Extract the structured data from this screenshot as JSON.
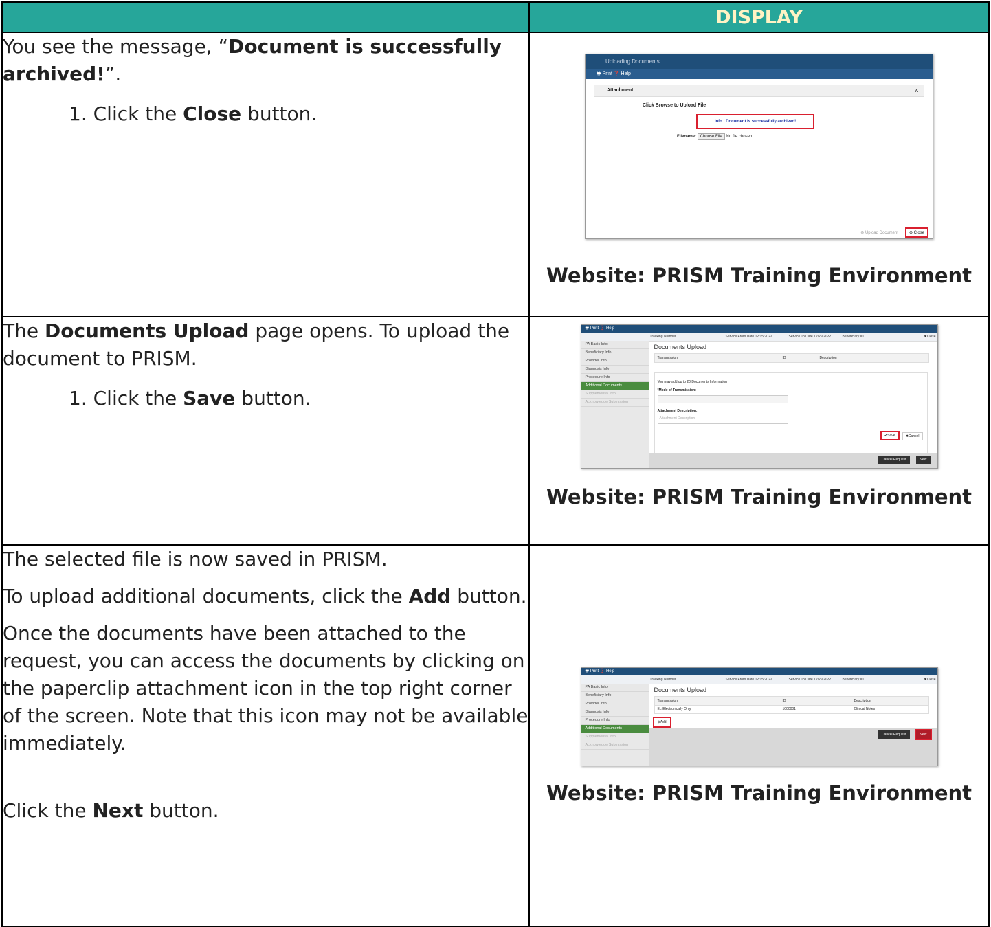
{
  "header": {
    "left": "",
    "right": "DISPLAY"
  },
  "rows": [
    {
      "intro_prefix": "You see the message, “",
      "intro_bold": "Document is successfully archived!",
      "intro_suffix": "”.",
      "step_pre": "1.  Click the ",
      "step_bold": "Close",
      "step_post": " button.",
      "caption": "Website: PRISM Training Environment"
    },
    {
      "intro_prefix": "The ",
      "intro_bold": "Documents Upload",
      "intro_suffix": " page opens. To upload the document to PRISM.",
      "step_pre": "1.  Click the ",
      "step_bold": "Save",
      "step_post": " button.",
      "caption": "Website: PRISM Training Environment"
    },
    {
      "p1": "The selected file is now saved in PRISM.",
      "p2_pre": "To upload additional documents, click the ",
      "p2_bold": "Add",
      "p2_post": " button.",
      "p3": "Once the documents have been attached to the request, you can access the documents by clicking on the paperclip attachment icon in the top right corner of the screen. Note that this icon may not be available immediately.",
      "p4_pre": "Click the ",
      "p4_bold": "Next",
      "p4_post": " button.",
      "caption": "Website: PRISM Training Environment"
    }
  ],
  "shot1": {
    "title": "Uploading Documents",
    "toolbar": "🖶 Print  ❓ Help",
    "panel_title": "Attachment:",
    "browse": "Click Browse to Upload File",
    "info": "Info :  Document is successfully archived!",
    "filename_label": "Filename:",
    "choose": "Choose File",
    "nofile": "No file chosen",
    "upload_btn": "⊕ Upload Document",
    "close_btn": "⊗ Close"
  },
  "portal": {
    "toolbar": "🖶 Print  ❓ Help",
    "tracking": "Tracking Number",
    "from": "Service From Date 12/15/2022",
    "to": "Service To Date 12/29/2022",
    "bene": "Beneficiary ID",
    "close": "✖Close",
    "side": [
      "PA Basic Info",
      "Beneficiary Info",
      "Provider Info",
      "Diagnosis Info",
      "Procedure Info",
      "Additional Documents",
      "Supplemental Info",
      "Acknowledge Submission"
    ],
    "page_title": "Documents Upload",
    "col_transmission": "Transmission",
    "col_id": "ID",
    "col_description": "Description",
    "form_note": "You may add up to 20 Documents Information",
    "mode_label": "*Mode of Transmission:",
    "desc_label": "Attachment Description:",
    "desc_placeholder": "Attachment Description",
    "save": "✔Save",
    "cancel": "✖Cancel",
    "cancel_request": "Cancel Request",
    "next": "Next",
    "row_transmission": "EL-Electronically Only",
    "row_id": "1000001",
    "row_description": "Clinical Notes",
    "add": "⊕Add"
  }
}
